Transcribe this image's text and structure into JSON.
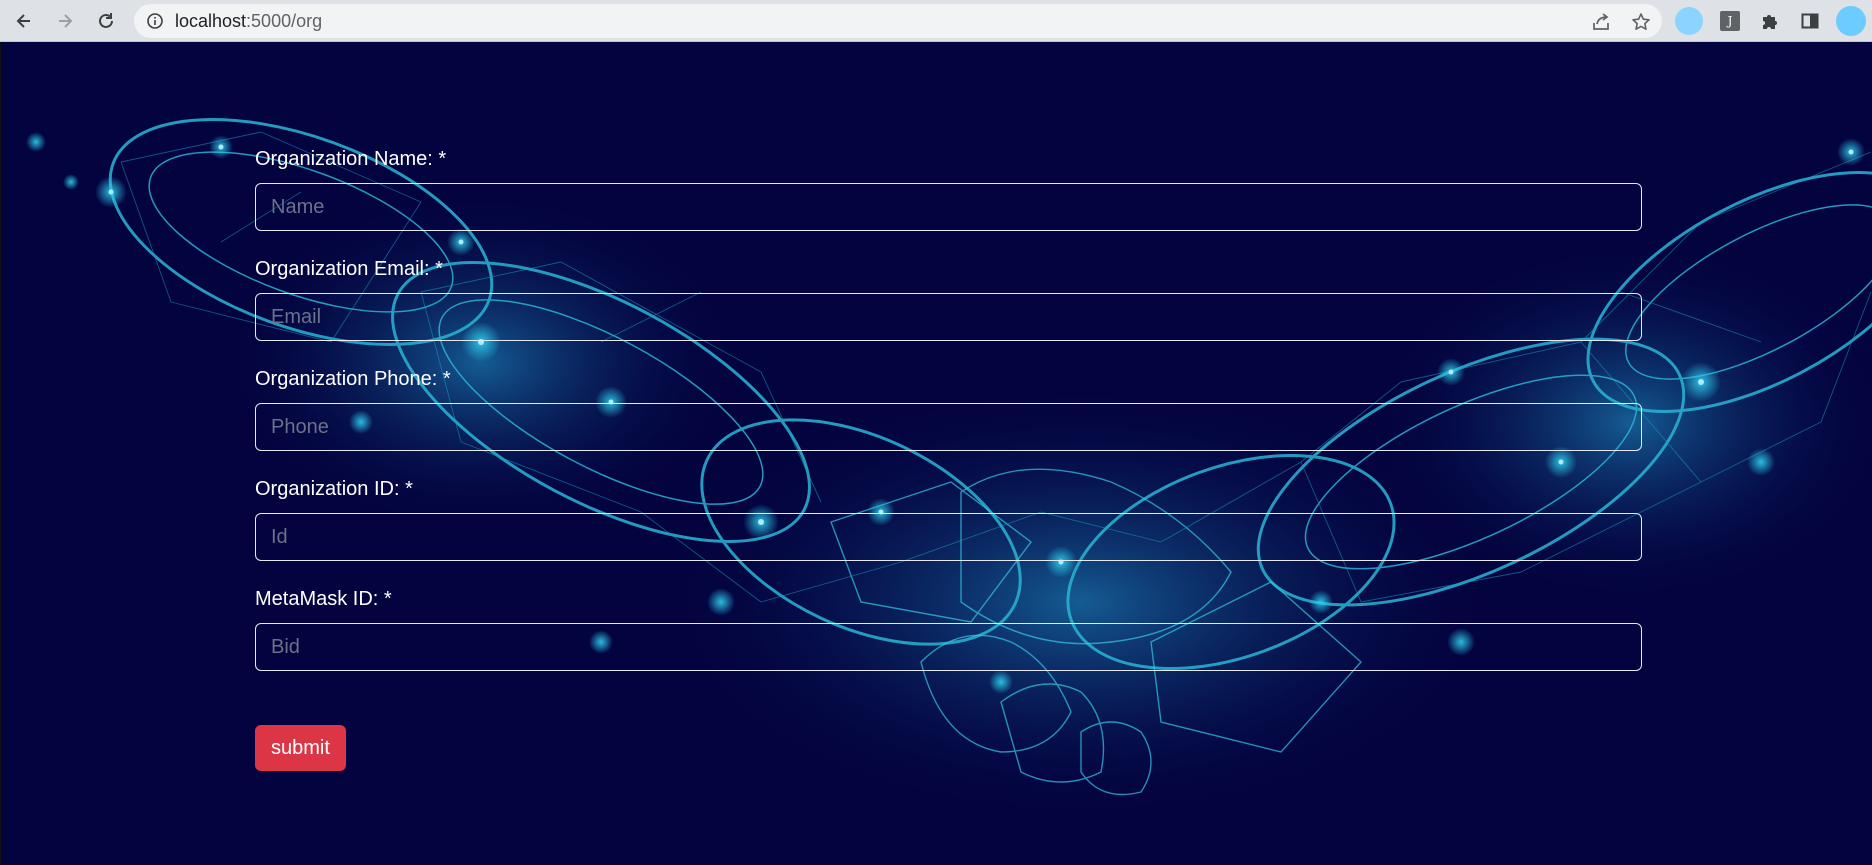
{
  "browser": {
    "url_host": "localhost",
    "url_path": ":5000/org",
    "accent_profile": "#8ad4ff"
  },
  "icons": {
    "back": "back-arrow-icon",
    "forward": "forward-arrow-icon",
    "reload": "reload-icon",
    "info": "info-icon",
    "share": "share-icon",
    "bookmark": "star-icon",
    "extensions": "puzzle-icon",
    "sidepanel": "side-panel-icon"
  },
  "extension_label": "J",
  "form": {
    "fields": [
      {
        "label": "Organization Name: *",
        "placeholder": "Name",
        "value": ""
      },
      {
        "label": "Organization Email: *",
        "placeholder": "Email",
        "value": ""
      },
      {
        "label": "Organization Phone: *",
        "placeholder": "Phone",
        "value": ""
      },
      {
        "label": "Organization ID: *",
        "placeholder": "Id",
        "value": ""
      },
      {
        "label": "MetaMask ID: *",
        "placeholder": "Bid",
        "value": ""
      }
    ],
    "submit_label": "submit",
    "submit_color": "#dc3545"
  },
  "colors": {
    "page_background": "#03033f",
    "chain_glow": "#19a7c9"
  }
}
